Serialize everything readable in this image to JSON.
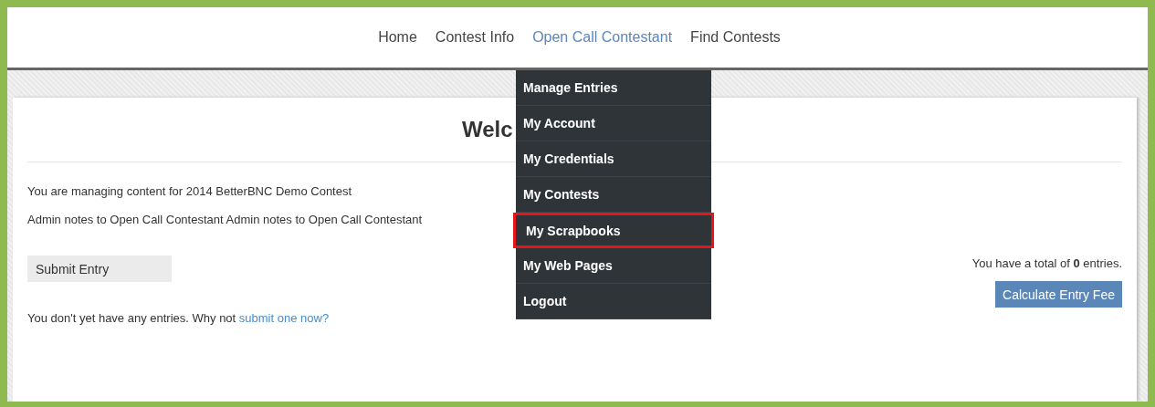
{
  "nav": [
    {
      "label": "Home",
      "selected": false
    },
    {
      "label": "Contest Info",
      "selected": false
    },
    {
      "label": "Open Call Contestant",
      "selected": true
    },
    {
      "label": "Find Contests",
      "selected": false
    }
  ],
  "dropdown": [
    {
      "label": "Manage Entries",
      "selected": false
    },
    {
      "label": "My Account",
      "selected": false
    },
    {
      "label": "My Credentials",
      "selected": false
    },
    {
      "label": "My Contests",
      "selected": false
    },
    {
      "label": "My Scrapbooks",
      "selected": true
    },
    {
      "label": "My Web Pages",
      "selected": false
    },
    {
      "label": "Logout",
      "selected": false
    }
  ],
  "heading": "Welc",
  "info": [
    "You are managing content for 2014 BetterBNC Demo Contest",
    "Admin notes to Open Call Contestant Admin notes to Open Call Contestant"
  ],
  "submit_button": "Submit Entry",
  "empty_message": {
    "text": "You don't yet have any entries. Why not",
    "link": "submit one now?"
  },
  "total": "You have a total of **0** entries.",
  "fee_button": "Calculate Entry Fee"
}
